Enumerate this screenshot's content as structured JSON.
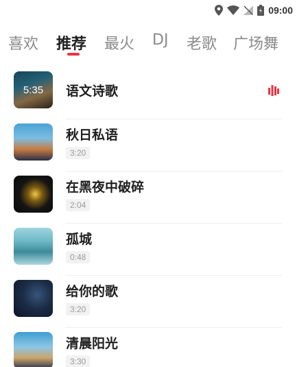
{
  "status_bar": {
    "time": "09:00",
    "icons": [
      "location-icon",
      "wifi-icon",
      "no-signal-icon",
      "battery-icon"
    ]
  },
  "tabs": [
    {
      "label": "喜欢",
      "active": false
    },
    {
      "label": "推荐",
      "active": true
    },
    {
      "label": "最火",
      "active": false
    },
    {
      "label": "DJ",
      "active": false
    },
    {
      "label": "老歌",
      "active": false
    },
    {
      "label": "广场舞",
      "active": false
    }
  ],
  "colors": {
    "accent": "#ee3344",
    "tab_active": "#1f1f1f",
    "tab_inactive": "#8a8a8a",
    "badge_bg": "#f2f2f2",
    "badge_text": "#9b9b9b"
  },
  "songs": [
    {
      "title": "语文诗歌",
      "cover_overlay": "5:35",
      "playing": true,
      "playing_icon": "equalizer-icon"
    },
    {
      "title": "秋日私语",
      "duration": "3:20"
    },
    {
      "title": "在黑夜中破碎",
      "duration": "2:04"
    },
    {
      "title": "孤城",
      "duration": "0:48"
    },
    {
      "title": "给你的歌",
      "duration": "3:20"
    },
    {
      "title": "清晨阳光",
      "duration": "3:30"
    }
  ]
}
